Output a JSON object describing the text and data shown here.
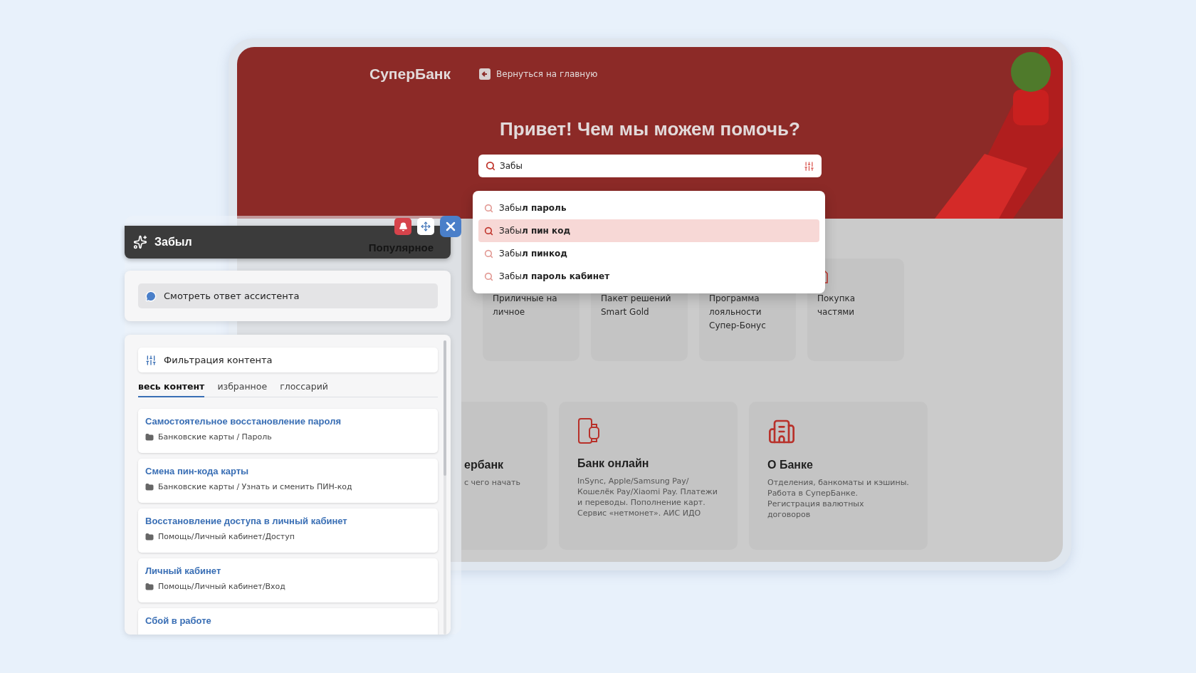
{
  "header": {
    "logo": "СуперБанк",
    "back_link": "Вернуться на главную"
  },
  "hero": {
    "title": "Привет! Чем мы можем помочь?",
    "search_value": "Забы"
  },
  "suggestions": [
    {
      "text": "Забы**л пароль**",
      "selected": false
    },
    {
      "text": "Забы**л пин код**",
      "selected": true
    },
    {
      "text": "Забы**л пинкод**",
      "selected": false
    },
    {
      "text": "Забы**л пароль кабинет**",
      "selected": false
    }
  ],
  "top_cards": [
    {
      "title": "Приличные на личное"
    },
    {
      "title": "Пакет решений Smart Gold"
    },
    {
      "title": "Программа лояльности Супер-Бонус"
    },
    {
      "title": "Покупка частями"
    }
  ],
  "bottom_cards": [
    {
      "kind": "partial",
      "title": "ербанк",
      "text": "с чего начать"
    },
    {
      "kind": "devices",
      "title": "Банк онлайн",
      "text": "InSync, Apple/Samsung Pay/ Кошелёк Pay/Xiaomi Pay. Платежи и переводы. Пополнение карт. Сервис «нетмонет». АИС ИДО"
    },
    {
      "kind": "building",
      "title": "О Банке",
      "text": "Отделения, банкоматы и кэшины. Работа в СуперБанке. Регистрация валютных договоров"
    }
  ],
  "panel": {
    "title": "Забыл",
    "popular": "Популярное",
    "assistant_button": "Смотреть ответ ассистента",
    "filter": "Фильтрация контента",
    "tabs": [
      {
        "label": "весь контент",
        "selected": true
      },
      {
        "label": "избранное",
        "selected": false
      },
      {
        "label": "глоссарий",
        "selected": false
      }
    ],
    "results": [
      {
        "title": "Самостоятельное восстановление пароля",
        "path": "Банковские карты / Пароль"
      },
      {
        "title": "Смена пин-кода карты",
        "path": "Банковские карты / Узнать и сменить ПИН-код"
      },
      {
        "title": "Восстановление доступа в личный кабинет",
        "path": "Помощь/Личный кабинет/Доступ"
      },
      {
        "title": "Личный кабинет",
        "path": "Помощь/Личный кабинет/Вход"
      },
      {
        "title": "Сбой в работе"
      }
    ]
  }
}
